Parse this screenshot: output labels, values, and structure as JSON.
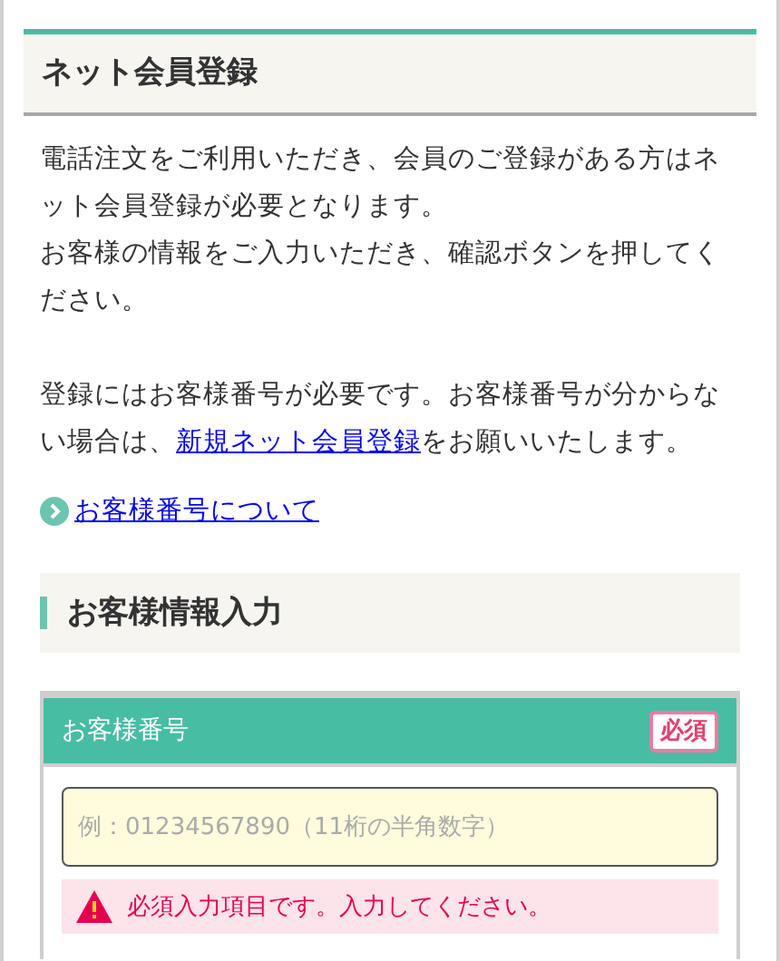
{
  "page_title": "ネット会員登録",
  "intro": [
    "電話注文をご利用いただき、会員のご登録がある方はネット会員登録が必要となります。",
    "お客様の情報をご入力いただき、確認ボタンを押してください。"
  ],
  "notice": {
    "before": "登録にはお客様番号が必要です。お客様番号が分からない場合は、",
    "link": "新規ネット会員登録",
    "after": "をお願いいたします。"
  },
  "help_link": "お客様番号について",
  "section_title": "お客様情報入力",
  "field": {
    "label": "お客様番号",
    "required": true,
    "badge": "必須",
    "placeholder": "例：01234567890（11桁の半角数字）",
    "error": "必須入力項目です。入力してください。"
  }
}
